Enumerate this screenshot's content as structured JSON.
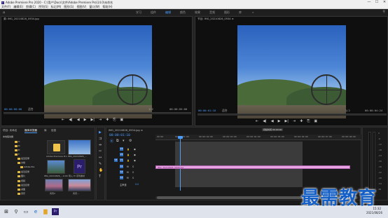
{
  "window": {
    "title": "Adobe Premiere Pro 2020 - C:\\用户\\Docs\\文件\\Adobe Premiere Pro\\14.0\\未命名",
    "app_icon": "Pr",
    "minimize": "—",
    "maximize": "☐",
    "close": "✕"
  },
  "menu": [
    "文件(F)",
    "编辑(E)",
    "剪辑(C)",
    "序列(S)",
    "标记(M)",
    "图形(G)",
    "视图(V)",
    "窗口(W)",
    "帮助(H)"
  ],
  "workspaces": {
    "home_icon": "⌂",
    "items": [
      "学习",
      "组件",
      "编辑",
      "颜色",
      "效果",
      "音频",
      "图形",
      "库"
    ],
    "active": "编辑",
    "more": "»"
  },
  "source_monitor": {
    "tab": "源: IMG_20210826_0934.jpg",
    "timecode_left": "00:00:00:00",
    "fit": "适合",
    "scale": "1/2",
    "timecode_right": "00:00:05:00"
  },
  "program_monitor": {
    "tab": "节目: IMG_20210826_0934 ≡",
    "timecode_left": "00:00:01:10",
    "fit": "适合",
    "scale": "1/2",
    "timecode_right": "00:00:04:24"
  },
  "transport": {
    "buttons": [
      "⇤",
      "◀|",
      "◀",
      "▶",
      "▶|",
      "⇥",
      "✚",
      "⎘",
      "▣"
    ]
  },
  "project_panel": {
    "tabs": [
      "项目: 未命名",
      "媒体浏览器",
      "库",
      "信息"
    ],
    "tree_items": [
      "本地驱动器",
      "C:",
      "D:",
      "E:",
      "F:",
      "最近目录",
      "文档",
      "Adobe Pre",
      "最近目录",
      "图片",
      "视频",
      "最近目录",
      "桌面",
      "音乐"
    ],
    "thumbnails": [
      {
        "label": "Adobe Premiere Pro"
      },
      {
        "label": "IMG_20210826_..."
      },
      {
        "label": "IMG_20210826_...9:00"
      },
      {
        "label": "导入 Pr 序列素材"
      },
      {
        "label": "IMG_20210828_..."
      },
      {
        "label": "风景2"
      },
      {
        "label": "风景..."
      }
    ]
  },
  "timeline": {
    "tab": "IMG_20210826_0934.jpg ≡",
    "timecode": "00:00:01:10",
    "ruler_labels": [
      "00:00",
      "00:00:01:00",
      "00:00:02:00",
      "00:00:03:00",
      "00:00:04:00",
      "00:00:05:00",
      "00:00:06:00",
      "00:00:07:00",
      "00:00:08:00"
    ],
    "tooltip": "持续时间 00:00:00",
    "tracks": [
      {
        "name": "V3"
      },
      {
        "name": "V2"
      },
      {
        "name": "V1"
      },
      {
        "name": "A1"
      },
      {
        "name": "A2"
      },
      {
        "name": "A3"
      }
    ],
    "master": "主声道",
    "master_value": "0.0",
    "clip_label": "IMG_20210826_0934.jpg"
  },
  "meter": {
    "labels": [
      "0",
      "-6",
      "-12",
      "-18",
      "-24",
      "-30",
      "-36",
      "-42",
      "-48",
      "-54",
      "dB"
    ],
    "footer": "S S"
  },
  "taskbar": {
    "start_icon": "⊞",
    "search_icon": "⚲",
    "tray_time": "15:32",
    "tray_date": "2021/08/26"
  },
  "watermark": "最需教育"
}
